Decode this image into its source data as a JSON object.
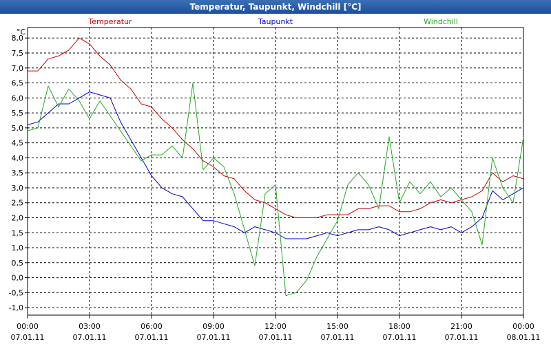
{
  "window": {
    "title": "Temperatur, Taupunkt, Windchill [°C]"
  },
  "chart_data": {
    "type": "line",
    "title": "Temperatur, Taupunkt, Windchill [°C]",
    "ylabel": "°C",
    "ylim": [
      -1.25,
      8.35
    ],
    "xlim_hours": [
      0,
      24
    ],
    "y_ticks": [
      "8,0",
      "7,5",
      "7,0",
      "6,5",
      "6,0",
      "5,5",
      "5,0",
      "4,5",
      "4,0",
      "3,5",
      "3,0",
      "2,5",
      "2,0",
      "1,5",
      "1,0",
      "0,5",
      "0,0",
      "-0,5",
      "-1,0"
    ],
    "x_ticks": [
      {
        "time": "00:00",
        "date": "07.01.11"
      },
      {
        "time": "03:00",
        "date": "07.01.11"
      },
      {
        "time": "06:00",
        "date": "07.01.11"
      },
      {
        "time": "09:00",
        "date": "07.01.11"
      },
      {
        "time": "12:00",
        "date": "07.01.11"
      },
      {
        "time": "15:00",
        "date": "07.01.11"
      },
      {
        "time": "18:00",
        "date": "07.01.11"
      },
      {
        "time": "21:00",
        "date": "07.01.11"
      },
      {
        "time": "00:00",
        "date": "08.01.11"
      }
    ],
    "grid": true,
    "legend_placement": "top",
    "x": [
      0,
      0.5,
      1,
      1.5,
      2,
      2.5,
      3,
      3.5,
      4,
      4.5,
      5,
      5.5,
      6,
      6.5,
      7,
      7.5,
      8,
      8.5,
      9,
      9.5,
      10,
      10.5,
      11,
      11.5,
      12,
      12.5,
      13,
      13.5,
      14,
      14.5,
      15,
      15.5,
      16,
      16.5,
      17,
      17.5,
      18,
      18.5,
      19,
      19.5,
      20,
      20.5,
      21,
      21.5,
      22,
      22.5,
      23,
      23.5,
      24
    ],
    "series": [
      {
        "name": "Temperatur",
        "color": "#cc0000",
        "values": [
          6.9,
          6.9,
          7.3,
          7.4,
          7.6,
          8.0,
          7.8,
          7.4,
          7.1,
          6.6,
          6.3,
          5.8,
          5.7,
          5.3,
          5.0,
          4.6,
          4.3,
          3.9,
          3.7,
          3.4,
          3.3,
          2.9,
          2.6,
          2.5,
          2.3,
          2.1,
          2.0,
          2.0,
          2.0,
          2.1,
          2.1,
          2.1,
          2.3,
          2.3,
          2.4,
          2.4,
          2.2,
          2.2,
          2.3,
          2.5,
          2.6,
          2.5,
          2.6,
          2.7,
          2.9,
          3.5,
          3.2,
          3.4,
          3.3
        ]
      },
      {
        "name": "Taupunkt",
        "color": "#0000cc",
        "values": [
          5.1,
          5.2,
          5.5,
          5.8,
          5.8,
          6.0,
          6.2,
          6.1,
          6.0,
          5.2,
          4.6,
          4.0,
          3.4,
          3.0,
          2.8,
          2.7,
          2.3,
          1.9,
          1.9,
          1.8,
          1.7,
          1.5,
          1.7,
          1.6,
          1.5,
          1.3,
          1.3,
          1.3,
          1.4,
          1.5,
          1.4,
          1.5,
          1.6,
          1.6,
          1.7,
          1.6,
          1.4,
          1.5,
          1.6,
          1.7,
          1.6,
          1.7,
          1.5,
          1.7,
          2.0,
          2.9,
          2.6,
          2.8,
          3.0
        ]
      },
      {
        "name": "Windchill",
        "color": "#22aa22",
        "values": [
          4.9,
          5.0,
          6.4,
          5.7,
          6.3,
          5.9,
          5.3,
          5.9,
          5.4,
          4.9,
          4.4,
          3.9,
          4.1,
          4.1,
          4.4,
          4.0,
          6.5,
          3.6,
          4.0,
          3.7,
          2.8,
          1.6,
          0.4,
          2.8,
          3.1,
          -0.6,
          -0.5,
          -0.1,
          0.7,
          1.3,
          1.9,
          3.1,
          3.5,
          3.1,
          2.3,
          4.7,
          2.5,
          3.2,
          2.8,
          3.2,
          2.7,
          3.0,
          2.6,
          2.2,
          1.1,
          4.0,
          3.0,
          2.5,
          4.7
        ]
      }
    ]
  }
}
